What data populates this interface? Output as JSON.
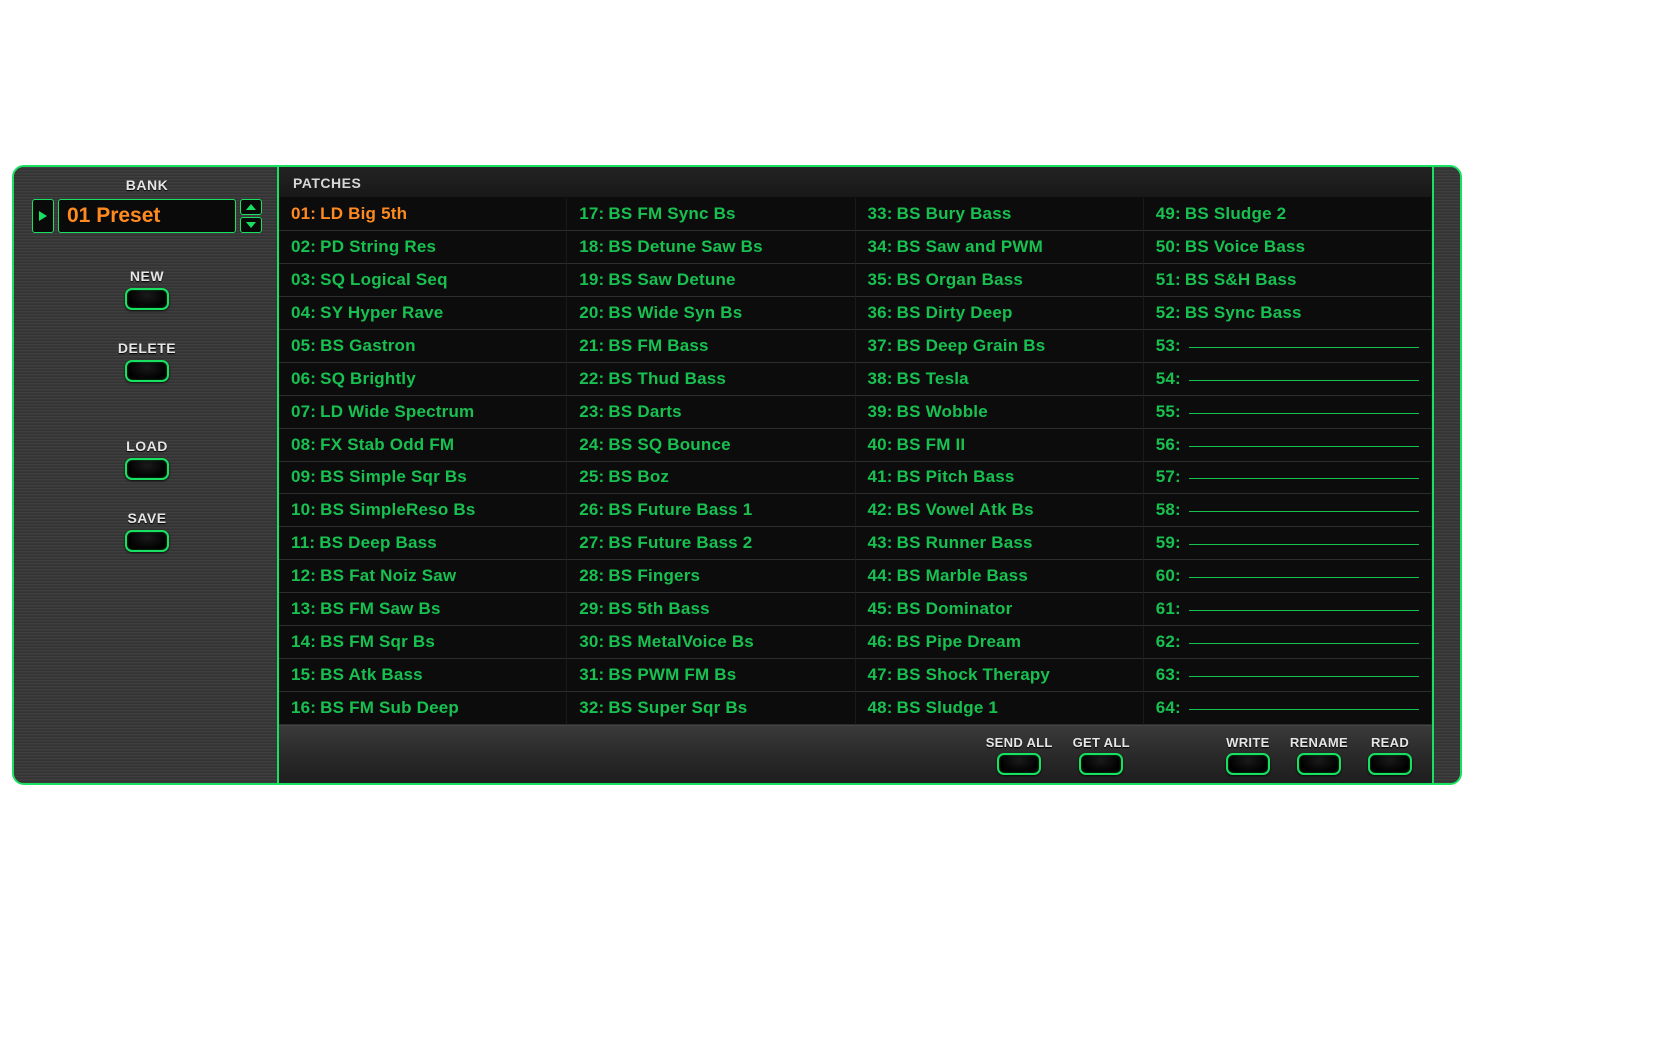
{
  "sidebar": {
    "bank_label": "BANK",
    "bank_value": "01 Preset",
    "buttons": {
      "new": "NEW",
      "delete": "DELETE",
      "load": "LOAD",
      "save": "SAVE"
    }
  },
  "patches": {
    "header": "PATCHES",
    "selected": 1,
    "items": [
      "LD Big 5th",
      "PD String Res",
      "SQ Logical Seq",
      "SY Hyper Rave",
      "BS Gastron",
      "SQ Brightly",
      "LD Wide Spectrum",
      "FX Stab Odd FM",
      "BS Simple Sqr Bs",
      "BS SimpleReso Bs",
      "BS Deep Bass",
      "BS Fat Noiz Saw",
      "BS FM Saw Bs",
      "BS FM Sqr Bs",
      "BS Atk Bass",
      "BS FM Sub Deep",
      "BS FM Sync Bs",
      "BS Detune Saw Bs",
      "BS Saw Detune",
      "BS Wide Syn Bs",
      "BS FM Bass",
      "BS Thud Bass",
      "BS Darts",
      "BS SQ Bounce",
      "BS Boz",
      "BS Future Bass 1",
      "BS Future Bass 2",
      "BS Fingers",
      "BS 5th Bass",
      "BS MetalVoice Bs",
      "BS PWM FM Bs",
      "BS Super Sqr Bs",
      "BS Bury Bass",
      "BS Saw and PWM",
      "BS Organ Bass",
      "BS Dirty Deep",
      "BS Deep Grain Bs",
      "BS Tesla",
      "BS Wobble",
      "BS FM II",
      "BS Pitch Bass",
      "BS Vowel  Atk Bs",
      "BS Runner Bass",
      "BS Marble Bass",
      "BS Dominator",
      "BS Pipe Dream",
      "BS Shock Therapy",
      "BS Sludge 1",
      "BS Sludge 2",
      "BS Voice Bass",
      "BS S&H Bass",
      "BS Sync Bass",
      "",
      "",
      "",
      "",
      "",
      "",
      "",
      "",
      "",
      "",
      "",
      ""
    ]
  },
  "footer": {
    "send_all": "SEND ALL",
    "get_all": "GET ALL",
    "write": "WRITE",
    "rename": "RENAME",
    "read": "READ"
  }
}
